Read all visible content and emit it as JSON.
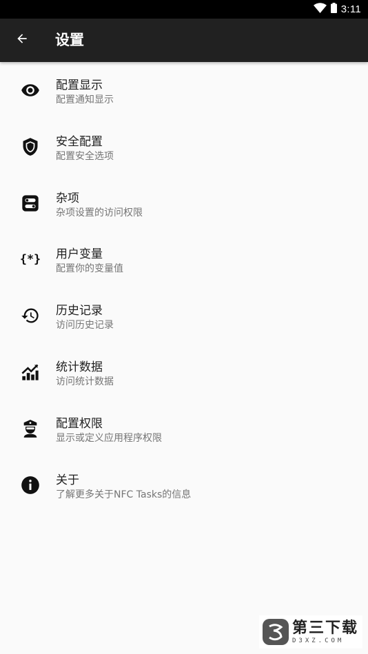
{
  "status_bar": {
    "time": "3:11"
  },
  "app_bar": {
    "title": "设置"
  },
  "settings": [
    {
      "title": "配置显示",
      "subtitle": "配置通知显示",
      "icon": "eye-icon"
    },
    {
      "title": "安全配置",
      "subtitle": "配置安全选项",
      "icon": "shield-icon"
    },
    {
      "title": "杂项",
      "subtitle": "杂项设置的访问权限",
      "icon": "toggle-box-icon"
    },
    {
      "title": "用户变量",
      "subtitle": "配置你的变量值",
      "icon": "variable-icon"
    },
    {
      "title": "历史记录",
      "subtitle": "访问历史记录",
      "icon": "history-icon"
    },
    {
      "title": "统计数据",
      "subtitle": "访问统计数据",
      "icon": "chart-icon"
    },
    {
      "title": "配置权限",
      "subtitle": "显示或定义应用程序权限",
      "icon": "police-icon"
    },
    {
      "title": "关于",
      "subtitle": "了解更多关于NFC Tasks的信息",
      "icon": "info-icon"
    }
  ],
  "watermark": {
    "title": "第三下载",
    "subtitle": "D3XZ.COM"
  }
}
